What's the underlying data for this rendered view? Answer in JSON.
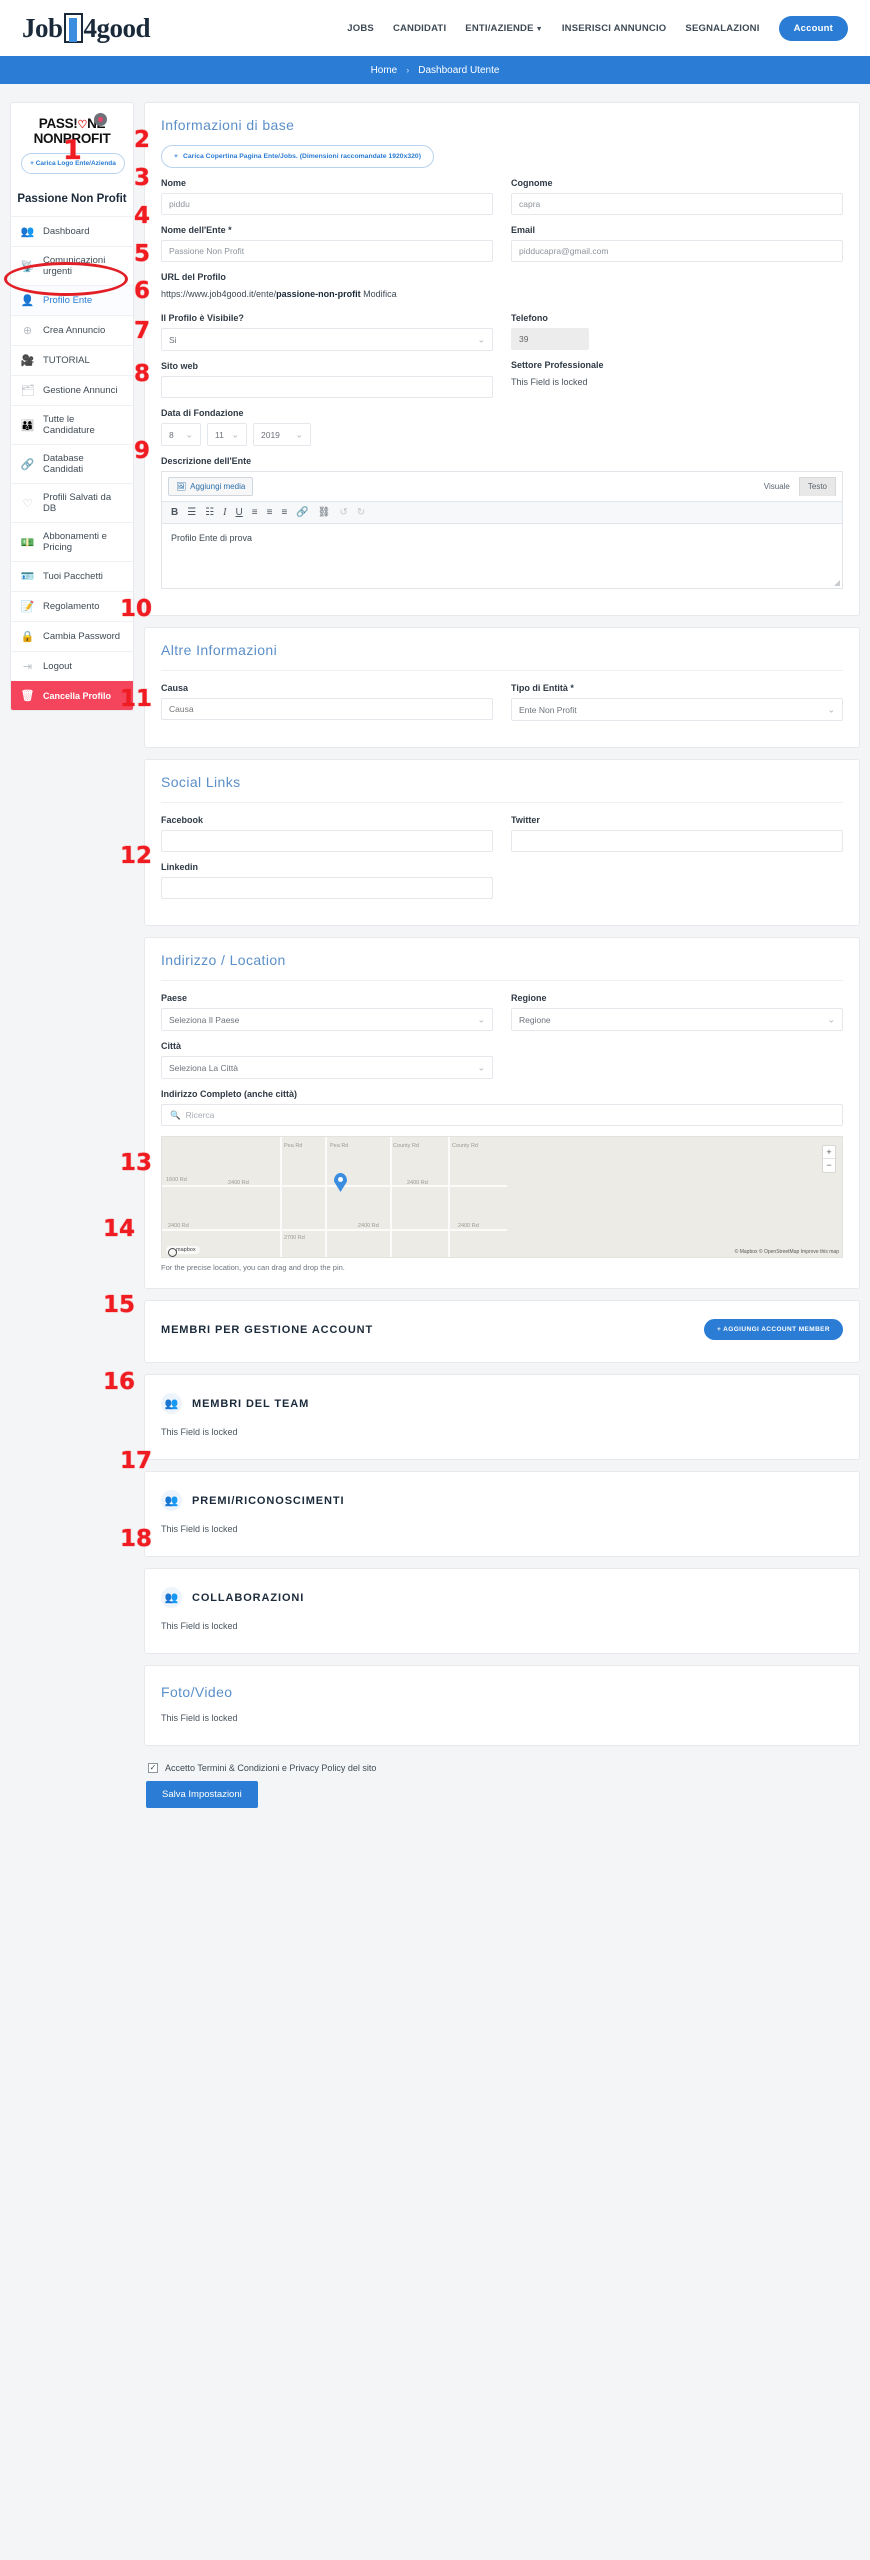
{
  "header": {
    "logo_text_a": "Job",
    "logo_text_b": "4good",
    "nav": [
      {
        "label": "JOBS",
        "caret": false
      },
      {
        "label": "CANDIDATI",
        "caret": false
      },
      {
        "label": "ENTI/AZIENDE",
        "caret": true
      },
      {
        "label": "INSERISCI ANNUNCIO",
        "caret": false
      },
      {
        "label": "SEGNALAZIONI",
        "caret": false
      }
    ],
    "account_label": "Account"
  },
  "breadcrumb": {
    "home": "Home",
    "separator": "›",
    "current": "Dashboard Utente"
  },
  "sidebar": {
    "logo_line1_a": "PASS!",
    "logo_line1_heart": "♡",
    "logo_line1_b": "NE",
    "logo_line2": "NONPROFIT",
    "upload_logo_label": "Carica Logo Ente/Azienda",
    "entity_name": "Passione Non Profit",
    "items": [
      {
        "label": "Dashboard",
        "icon": "group-icon"
      },
      {
        "label": "Comunicazioni urgenti",
        "icon": "broadcast-icon"
      },
      {
        "label": "Profilo Ente",
        "icon": "user-icon"
      },
      {
        "label": "Crea Annuncio",
        "icon": "plus-circle-icon"
      },
      {
        "label": "TUTORIAL",
        "icon": "video-icon"
      },
      {
        "label": "Gestione Annunci",
        "icon": "briefcase-icon"
      },
      {
        "label": "Tutte le Candidature",
        "icon": "people-grid-icon"
      },
      {
        "label": "Database Candidati",
        "icon": "link-icon"
      },
      {
        "label": "Profili Salvati da DB",
        "icon": "heart-icon"
      },
      {
        "label": "Abbonamenti e Pricing",
        "icon": "money-icon"
      },
      {
        "label": "Tuoi Pacchetti",
        "icon": "card-icon"
      },
      {
        "label": "Regolamento",
        "icon": "document-icon"
      },
      {
        "label": "Cambia Password",
        "icon": "lock-icon"
      },
      {
        "label": "Logout",
        "icon": "exit-icon"
      },
      {
        "label": "Cancella Profilo",
        "icon": "trash-icon"
      }
    ]
  },
  "base_info": {
    "title": "Informazioni di base",
    "upload_cover_label": "Carica Copertina Pagina Ente/Jobs. (Dimensioni raccomandate 1920x320)",
    "nome_label": "Nome",
    "nome_value": "piddu",
    "cognome_label": "Cognome",
    "cognome_value": "capra",
    "nome_ente_label": "Nome dell'Ente *",
    "nome_ente_value": "Passione Non Profit",
    "email_label": "Email",
    "email_value": "pidducapra@gmail.com",
    "url_label": "URL del Profilo",
    "url_prefix": "https://www.job4good.it/ente/",
    "url_slug": "passione-non-profit",
    "url_modify": "Modifica",
    "visible_label": "Il Profilo è Visibile?",
    "visible_value": "Si",
    "telefono_label": "Telefono",
    "telefono_value": "39",
    "sito_label": "Sito web",
    "sito_value": "",
    "settore_label": "Settore Professionale",
    "settore_value": "This Field is locked",
    "data_label": "Data di Fondazione",
    "data_day": "8",
    "data_month": "11",
    "data_year": "2019",
    "descr_label": "Descrizione dell'Ente",
    "add_media_label": "Aggiungi media",
    "tab_visual": "Visuale",
    "tab_text": "Testo",
    "descr_value": "Profilo Ente di prova"
  },
  "other_info": {
    "title": "Altre Informazioni",
    "causa_label": "Causa",
    "causa_placeholder": "Causa",
    "tipo_label": "Tipo di Entità *",
    "tipo_value": "Ente Non Profit"
  },
  "social": {
    "title": "Social Links",
    "facebook_label": "Facebook",
    "twitter_label": "Twitter",
    "linkedin_label": "Linkedin"
  },
  "address": {
    "title": "Indirizzo / Location",
    "paese_label": "Paese",
    "paese_value": "Seleziona Il Paese",
    "regione_label": "Regione",
    "regione_value": "Regione",
    "citta_label": "Città",
    "citta_value": "Seleziona La Città",
    "indirizzo_label": "Indirizzo Completo (anche città)",
    "indirizzo_placeholder": "Ricerca",
    "map_help": "For the precise location, you can drag and drop the pin.",
    "map_attribution": "© Mapbox © OpenStreetMap Improve this map",
    "map_logo": "mapbox",
    "map_zoom_in": "+",
    "map_zoom_out": "−",
    "map_roads": [
      "Pea Rd",
      "County Rd",
      "County Rd",
      "2400 Rd",
      "2400 Rd",
      "2400 Rd",
      "2400 Rd",
      "2400 Rd",
      "2400 Rd",
      "2700 Rd",
      "1600 Rd"
    ]
  },
  "account_members": {
    "title": "MEMBRI PER GESTIONE ACCOUNT",
    "add_button": "AGGIUNGI ACCOUNT MEMBER"
  },
  "team": {
    "title": "MEMBRI DEL TEAM",
    "locked": "This Field is locked"
  },
  "awards": {
    "title": "PREMI/RICONOSCIMENTI",
    "locked": "This Field is locked"
  },
  "collabs": {
    "title": "COLLABORAZIONI",
    "locked": "This Field is locked"
  },
  "media": {
    "title": "Foto/Video",
    "locked": "This Field is locked"
  },
  "footer": {
    "terms_label": "Accetto Termini & Condizioni e Privacy Policy del sito",
    "save_label": "Salva Impostazioni"
  },
  "annotations": [
    "1",
    "2",
    "3",
    "4",
    "5",
    "6",
    "7",
    "8",
    "9",
    "10",
    "11",
    "12",
    "13",
    "14",
    "15",
    "16",
    "17",
    "18"
  ]
}
